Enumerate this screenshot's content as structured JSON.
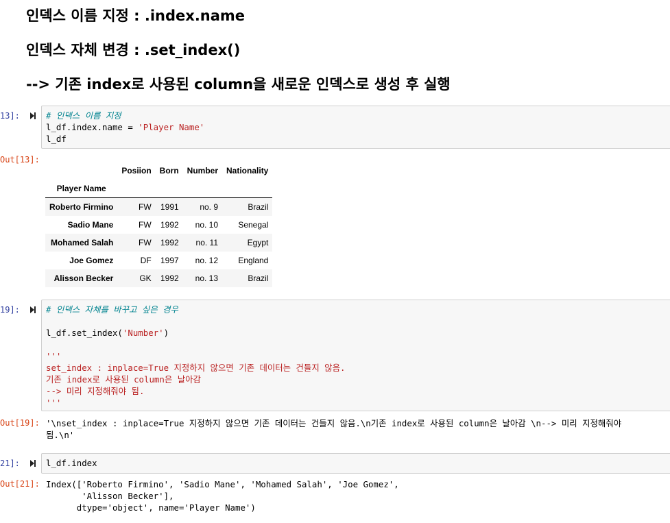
{
  "markdown": {
    "heading1": "인덱스 이름 지정 : .index.name",
    "heading2": "인덱스 자체 변경 : .set_index()",
    "heading3": "--> 기존 index로 사용된 column을 새로운 인덱스로 생성 후 실행"
  },
  "cells": [
    {
      "in_prompt": "13]:",
      "code": {
        "comment": "# 인덱스 이름 지정",
        "line2_prefix": "l_df.index.name = ",
        "line2_string": "'Player Name'",
        "line3": "l_df"
      },
      "out_prompt": "Out[13]:"
    },
    {
      "in_prompt": "19]:",
      "code": {
        "comment": "# 인덱스 자체를 바꾸고 싶은 경우",
        "call_prefix": "l_df.set_index(",
        "call_arg": "'Number'",
        "call_suffix": ")",
        "doc_open": "'''",
        "doc_line1": "set_index : inplace=True 지정하지 않으면 기존 데이터는 건들지 않음.",
        "doc_line2": "기존 index로 사용된 column은 날아감",
        "doc_line3": "--> 미리 지정해줘야 됨.",
        "doc_close": "'''"
      },
      "out_prompt": "Out[19]:",
      "output_line1": "'\\nset_index : inplace=True 지정하지 않으면 기존 데이터는 건들지 않음.\\n기존 index로 사용된 column은 날아감 \\n--> 미리 지정해줘야",
      "output_line2": "됨.\\n'"
    },
    {
      "in_prompt": "21]:",
      "code": {
        "line1": "l_df.index"
      },
      "out_prompt": "Out[21]:",
      "output_line1": "Index(['Roberto Firmino', 'Sadio Mane', 'Mohamed Salah', 'Joe Gomez',",
      "output_line2": "       'Alisson Becker'],",
      "output_line3": "      dtype='object', name='Player Name')"
    }
  ],
  "dataframe": {
    "columns": [
      "Posiion",
      "Born",
      "Number",
      "Nationality"
    ],
    "index_name": "Player Name",
    "rows": [
      {
        "index": "Roberto Firmino",
        "values": [
          "FW",
          "1991",
          "no. 9",
          "Brazil"
        ]
      },
      {
        "index": "Sadio Mane",
        "values": [
          "FW",
          "1992",
          "no. 10",
          "Senegal"
        ]
      },
      {
        "index": "Mohamed Salah",
        "values": [
          "FW",
          "1992",
          "no. 11",
          "Egypt"
        ]
      },
      {
        "index": "Joe Gomez",
        "values": [
          "DF",
          "1997",
          "no. 12",
          "England"
        ]
      },
      {
        "index": "Alisson Becker",
        "values": [
          "GK",
          "1992",
          "no. 13",
          "Brazil"
        ]
      }
    ]
  }
}
